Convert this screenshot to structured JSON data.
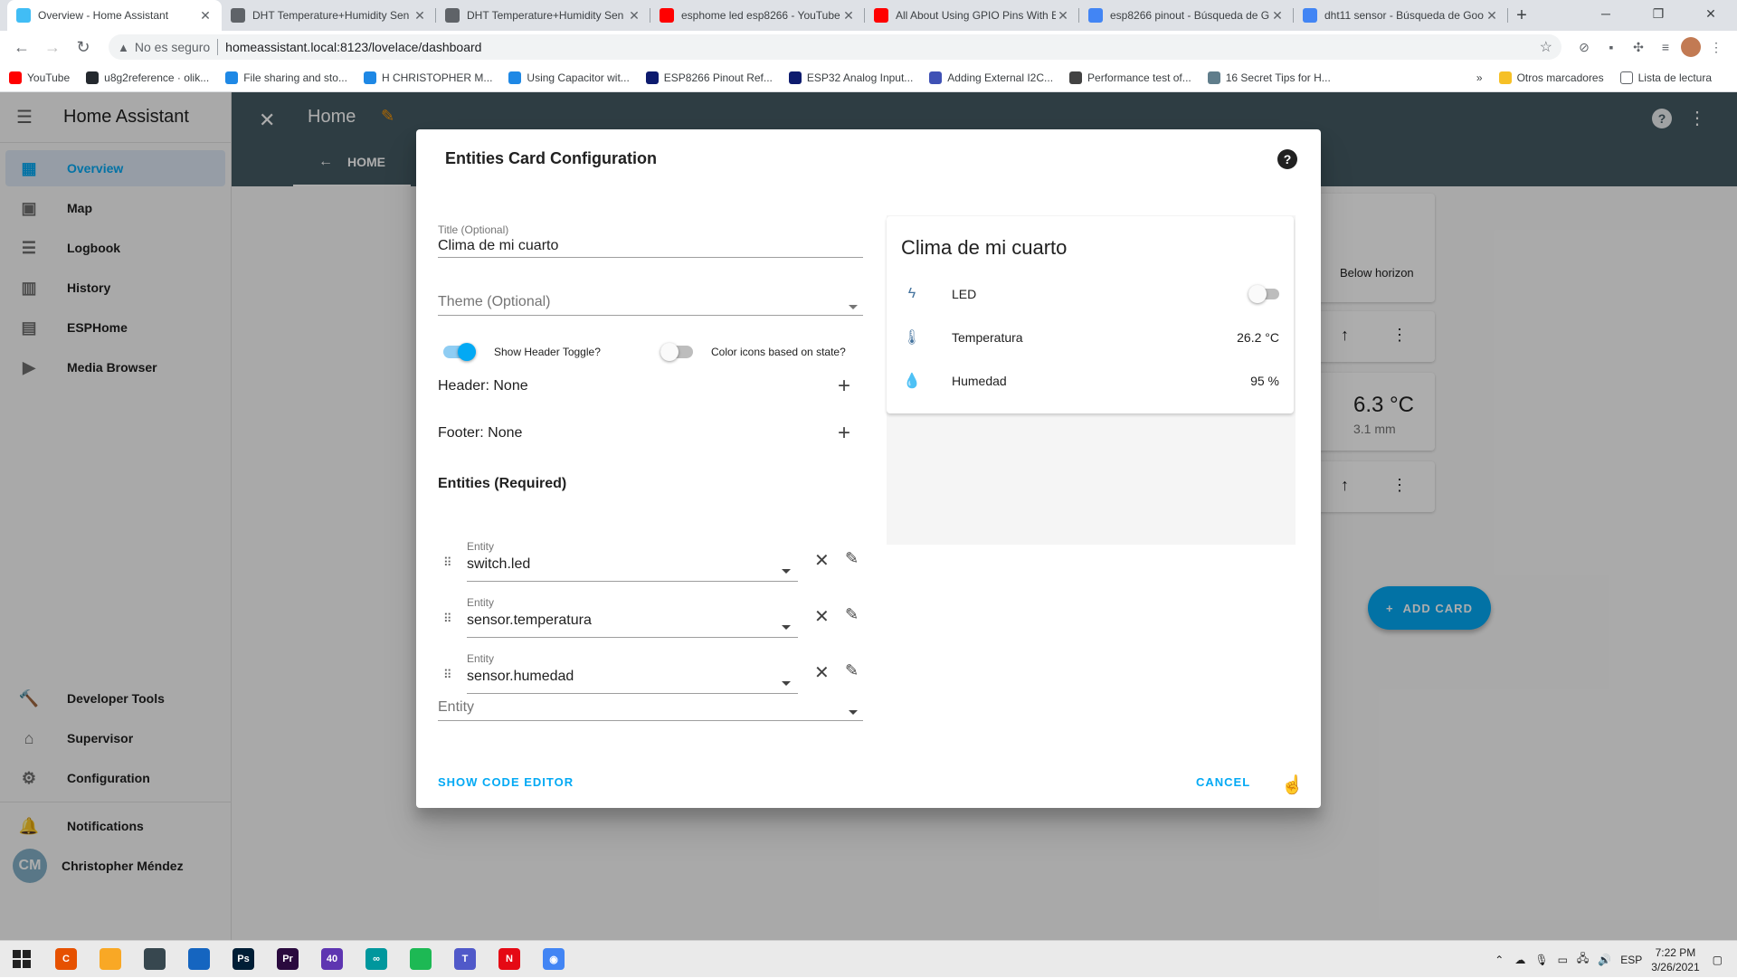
{
  "browser": {
    "tabs": [
      {
        "title": "Overview - Home Assistant",
        "icon": "home-assistant-icon",
        "color": "#41bdf5"
      },
      {
        "title": "DHT Temperature+Humidity Sen",
        "icon": "site-icon",
        "color": "#5f6368"
      },
      {
        "title": "DHT Temperature+Humidity Sen",
        "icon": "site-icon",
        "color": "#5f6368"
      },
      {
        "title": "esphome led esp8266 - YouTube",
        "icon": "youtube-icon",
        "color": "#ff0000"
      },
      {
        "title": "All About Using GPIO Pins With E",
        "icon": "youtube-icon",
        "color": "#ff0000"
      },
      {
        "title": "esp8266 pinout - Búsqueda de G",
        "icon": "google-icon",
        "color": "#4285f4"
      },
      {
        "title": "dht11 sensor - Búsqueda de Goo",
        "icon": "google-icon",
        "color": "#4285f4"
      }
    ],
    "security_label": "No es seguro",
    "url": "homeassistant.local:8123/lovelace/dashboard",
    "bookmarks": [
      {
        "label": "YouTube",
        "color": "#ff0000"
      },
      {
        "label": "u8g2reference · olik...",
        "color": "#24292e"
      },
      {
        "label": "File sharing and sto...",
        "color": "#1e88e5"
      },
      {
        "label": "H CHRISTOPHER M...",
        "color": "#1e88e5"
      },
      {
        "label": "Using Capacitor wit...",
        "color": "#1e88e5"
      },
      {
        "label": "ESP8266 Pinout Ref...",
        "color": "#0d1b6e"
      },
      {
        "label": "ESP32 Analog Input...",
        "color": "#0d1b6e"
      },
      {
        "label": "Adding External I2C...",
        "color": "#3f51b5"
      },
      {
        "label": "Performance test of...",
        "color": "#424242"
      },
      {
        "label": "16 Secret Tips for H...",
        "color": "#607d8b"
      }
    ],
    "bookmarks_more": "»",
    "other_bookmarks": "Otros marcadores",
    "reading_list": "Lista de lectura"
  },
  "sidebar": {
    "title": "Home Assistant",
    "items": [
      {
        "label": "Overview",
        "icon": "dashboard-icon",
        "glyph": "▦"
      },
      {
        "label": "Map",
        "icon": "map-icon",
        "glyph": "▣"
      },
      {
        "label": "Logbook",
        "icon": "logbook-icon",
        "glyph": "☰"
      },
      {
        "label": "History",
        "icon": "history-icon",
        "glyph": "▥"
      },
      {
        "label": "ESPHome",
        "icon": "esphome-icon",
        "glyph": "▤"
      },
      {
        "label": "Media Browser",
        "icon": "media-browser-icon",
        "glyph": "▶"
      }
    ],
    "bottom_items": [
      {
        "label": "Developer Tools",
        "icon": "hammer-icon",
        "glyph": "🔨"
      },
      {
        "label": "Supervisor",
        "icon": "supervisor-icon",
        "glyph": "⌂"
      },
      {
        "label": "Configuration",
        "icon": "gear-icon",
        "glyph": "⚙"
      }
    ],
    "notifications": "Notifications",
    "user": {
      "initials": "CM",
      "name": "Christopher Méndez"
    }
  },
  "appbar": {
    "title": "Home",
    "tab": "HOME"
  },
  "background": {
    "sun_state": "Below horizon",
    "weather_temp": "6.3 °C",
    "weather_precip": "3.1 mm",
    "add_card": "ADD CARD"
  },
  "dialog": {
    "title": "Entities Card Configuration",
    "title_field": {
      "label": "Title (Optional)",
      "value": "Clima de mi cuarto"
    },
    "theme_field": {
      "placeholder": "Theme (Optional)"
    },
    "show_header_toggle": {
      "label": "Show Header Toggle?",
      "on": true
    },
    "color_icons": {
      "label": "Color icons based on state?",
      "on": false
    },
    "header": "Header: None",
    "footer": "Footer: None",
    "entities_title": "Entities (Required)",
    "entity_label": "Entity",
    "entities": [
      "switch.led",
      "sensor.temperatura",
      "sensor.humedad"
    ],
    "new_entity_placeholder": "Entity",
    "show_code_editor": "SHOW CODE EDITOR",
    "cancel": "CANCEL",
    "preview": {
      "title": "Clima de mi cuarto",
      "rows": [
        {
          "name": "LED",
          "icon": "flash-icon",
          "glyph": "ϟ",
          "value": ""
        },
        {
          "name": "Temperatura",
          "icon": "thermometer-icon",
          "glyph": "🌡",
          "value": "26.2 °C"
        },
        {
          "name": "Humedad",
          "icon": "water-percent-icon",
          "glyph": "💧",
          "value": "95 %"
        }
      ]
    }
  },
  "taskbar": {
    "apps": [
      {
        "name": "app-codeblocks",
        "color": "#e65100",
        "label": "C"
      },
      {
        "name": "app-file-explorer",
        "color": "#f9a825",
        "label": ""
      },
      {
        "name": "app-store",
        "color": "#37474f",
        "label": ""
      },
      {
        "name": "app-mail",
        "color": "#1565c0",
        "label": ""
      },
      {
        "name": "app-photoshop",
        "color": "#001e36",
        "label": "Ps"
      },
      {
        "name": "app-premiere",
        "color": "#2a0a3e",
        "label": "Pr"
      },
      {
        "name": "app-obs",
        "color": "#5e35b1",
        "label": "40"
      },
      {
        "name": "app-arduino",
        "color": "#00979d",
        "label": "∞"
      },
      {
        "name": "app-spotify",
        "color": "#1db954",
        "label": ""
      },
      {
        "name": "app-teams",
        "color": "#5059c9",
        "label": "T"
      },
      {
        "name": "app-netflix",
        "color": "#e50914",
        "label": "N"
      },
      {
        "name": "app-chrome",
        "color": "#4285f4",
        "label": "◉"
      }
    ],
    "lang": "ESP",
    "time": "7:22 PM",
    "date": "3/26/2021"
  },
  "colors": {
    "accent": "#03a9f4",
    "appbar": "#455a64",
    "state_icon": "#44739e"
  }
}
